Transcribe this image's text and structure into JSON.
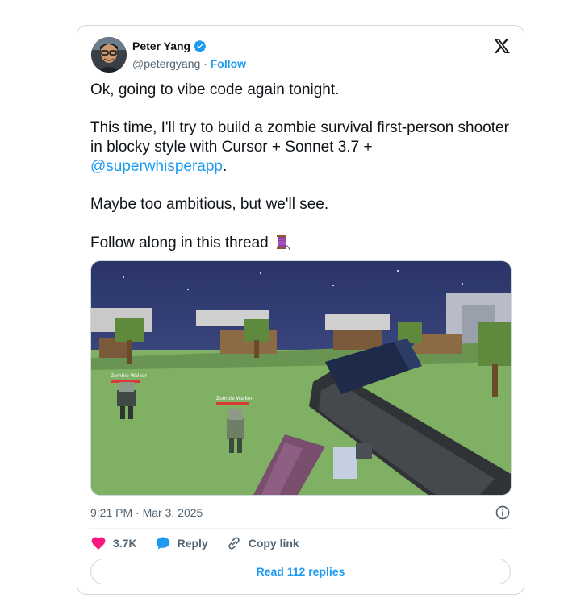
{
  "author": {
    "name": "Peter Yang",
    "handle": "@petergyang",
    "separator": "·",
    "follow_label": "Follow",
    "verified": true
  },
  "icons": {
    "verified": "verified-badge-icon",
    "brand": "x-logo-icon",
    "info": "info-icon",
    "like": "heart-icon",
    "reply": "reply-bubble-icon",
    "copy_link": "link-icon",
    "thread": "thread-spool-emoji"
  },
  "tweet": {
    "line1": "Ok, going to vibe code again tonight.",
    "line2": "This time, I'll try to build a zombie survival first-person shooter in blocky style with Cursor + Sonnet 3.7 +",
    "mention": "@superwhisperapp",
    "line2_end": ".",
    "line3": "Maybe too ambitious, but we'll see.",
    "line4": "Follow along in this thread"
  },
  "media": {
    "zombie_label_1": "Zombie Walker",
    "zombie_label_2": "Zombie Walker"
  },
  "meta": {
    "time": "9:21 PM",
    "separator": "·",
    "date": "Mar 3, 2025"
  },
  "actions": {
    "likes": "3.7K",
    "reply_label": "Reply",
    "copy_link_label": "Copy link"
  },
  "read_replies_label": "Read 112 replies",
  "colors": {
    "accent": "#1d9bf0",
    "like": "#f91880",
    "border": "#cfd9de",
    "muted": "#536471"
  }
}
